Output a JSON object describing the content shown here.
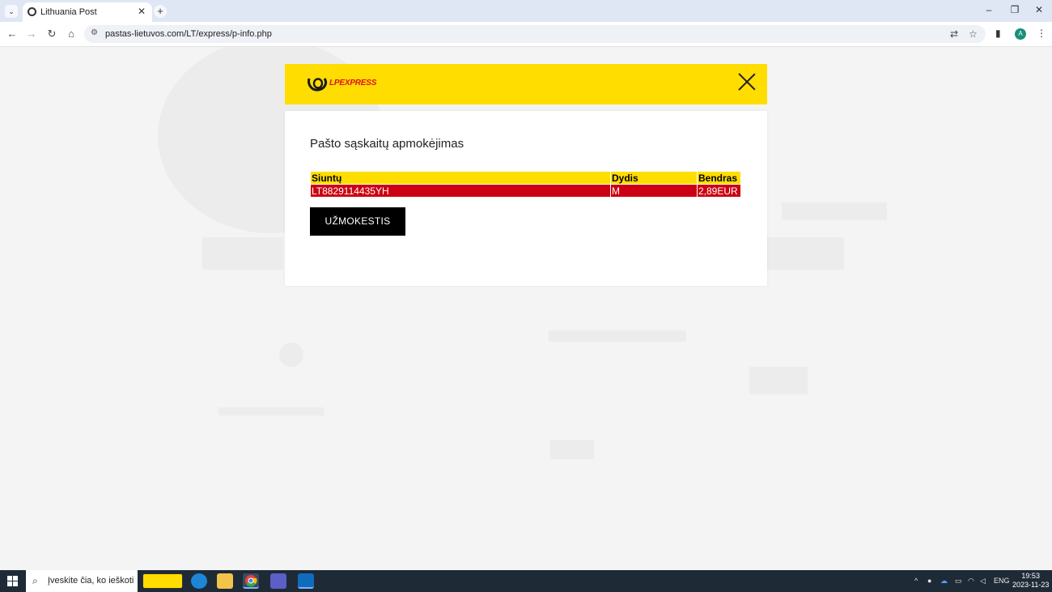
{
  "browser": {
    "tab_title": "Lithuania Post",
    "url": "pastas-lietuvos.com/LT/express/p-info.php",
    "avatar_letter": "A"
  },
  "modal": {
    "logo_text": "LPEXPRESS",
    "title": "Pašto sąskaitų apmokėjimas",
    "table": {
      "headers": [
        "Siuntų",
        "Dydis",
        "Bendras"
      ],
      "rows": [
        [
          "LT8829114435YH",
          "M",
          "2,89EUR"
        ]
      ]
    },
    "pay_button_label": "UŽMOKESTIS"
  },
  "taskbar": {
    "search_placeholder": "Įveskite čia, ko ieškoti",
    "language": "ENG",
    "time": "19:53",
    "date": "2023-11-23"
  },
  "colors": {
    "brand_yellow": "#ffdd00",
    "row_red": "#cc0012",
    "button_black": "#000000"
  }
}
